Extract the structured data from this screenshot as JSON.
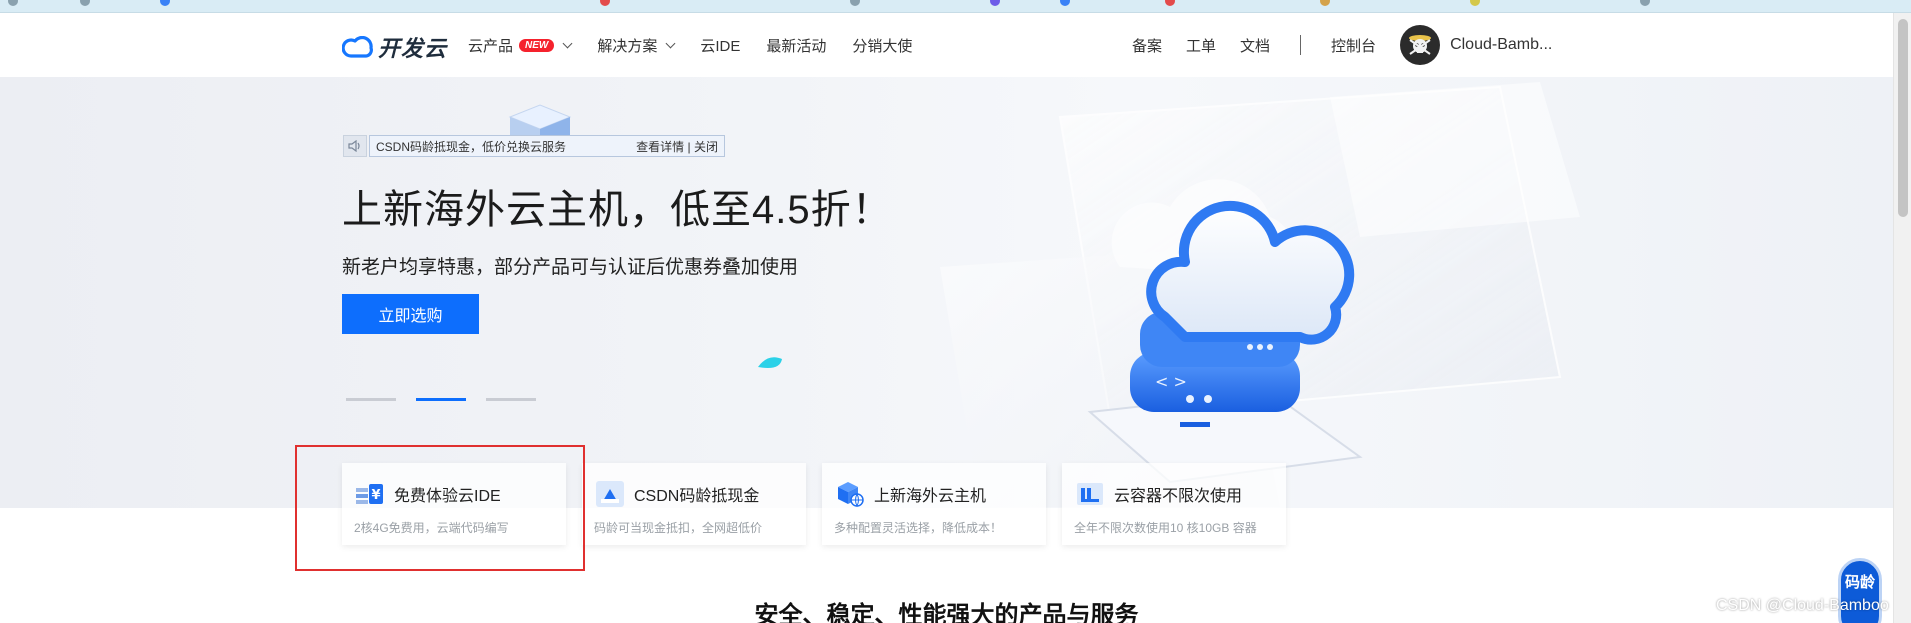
{
  "header": {
    "logo_text": "开发云",
    "nav": [
      {
        "label": "云产品",
        "badge": "NEW",
        "has_dropdown": true
      },
      {
        "label": "解决方案",
        "has_dropdown": true
      },
      {
        "label": "云IDE"
      },
      {
        "label": "最新活动"
      },
      {
        "label": "分销大使"
      }
    ],
    "right_links": [
      "备案",
      "工单",
      "文档"
    ],
    "console": "控制台",
    "username": "Cloud-Bamb..."
  },
  "hero": {
    "notice_text": "CSDN码龄抵现金，低价兑换云服务",
    "notice_details": "查看详情",
    "notice_separator": "|",
    "notice_close": "关闭",
    "title": "上新海外云主机，低至4.5折！",
    "subtitle": "新老户均享特惠，部分产品可与认证后优惠券叠加使用",
    "cta": "立即选购",
    "carousel": {
      "count": 3,
      "active_index": 1
    }
  },
  "cards": [
    {
      "title": "免费体验云IDE",
      "desc": "2核4G免费用，云端代码编写",
      "icon": "ide-coin-icon",
      "highlighted": true
    },
    {
      "title": "CSDN码龄抵现金",
      "desc": "码龄可当现金抵扣，全网超低价",
      "icon": "gift-icon"
    },
    {
      "title": "上新海外云主机",
      "desc": "多种配置灵活选择，降低成本！",
      "icon": "cube-globe-icon"
    },
    {
      "title": "云容器不限次使用",
      "desc": "全年不限次数使用10 核10GB 容器",
      "icon": "container-icon"
    }
  ],
  "section_title": "安全、稳定、性能强大的产品与服务",
  "float_button": "码龄",
  "watermark": "CSDN @Cloud-Bamboo",
  "colors": {
    "primary": "#0d6efd",
    "badge": "#f5222d",
    "highlight": "#e0302f"
  }
}
